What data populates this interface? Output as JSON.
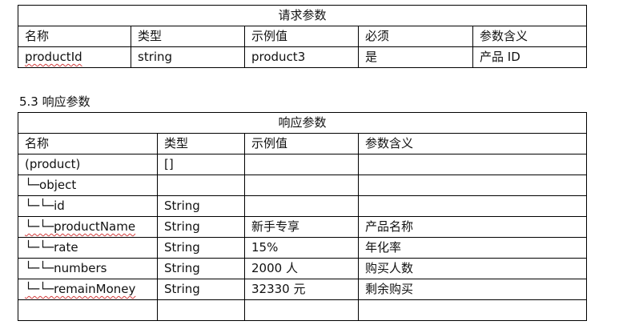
{
  "request_table": {
    "title": "请求参数",
    "headers": [
      "名称",
      "类型",
      "示例值",
      "必须",
      "参数含义"
    ],
    "rows": [
      [
        "productId",
        "string",
        "product3",
        "是",
        "产品 ID"
      ]
    ]
  },
  "response_section": {
    "heading": "5.3 响应参数"
  },
  "response_table": {
    "title": "响应参数",
    "headers": [
      "名称",
      "类型",
      "示例值",
      "参数含义"
    ],
    "rows": [
      [
        "(product)",
        "[]",
        "",
        ""
      ],
      [
        "└─object",
        "",
        "",
        ""
      ],
      [
        "└─└─id",
        "String",
        "",
        ""
      ],
      [
        "└─└─productName",
        "String",
        "新手专享",
        "产品名称"
      ],
      [
        "└─└─rate",
        "String",
        "15%",
        "年化率"
      ],
      [
        "└─└─numbers",
        "String",
        "2000 人",
        "购买人数"
      ],
      [
        "└─└─remainMoney",
        "String",
        "32330 元",
        "剩余购买"
      ],
      [
        "",
        "",
        "",
        ""
      ]
    ]
  }
}
